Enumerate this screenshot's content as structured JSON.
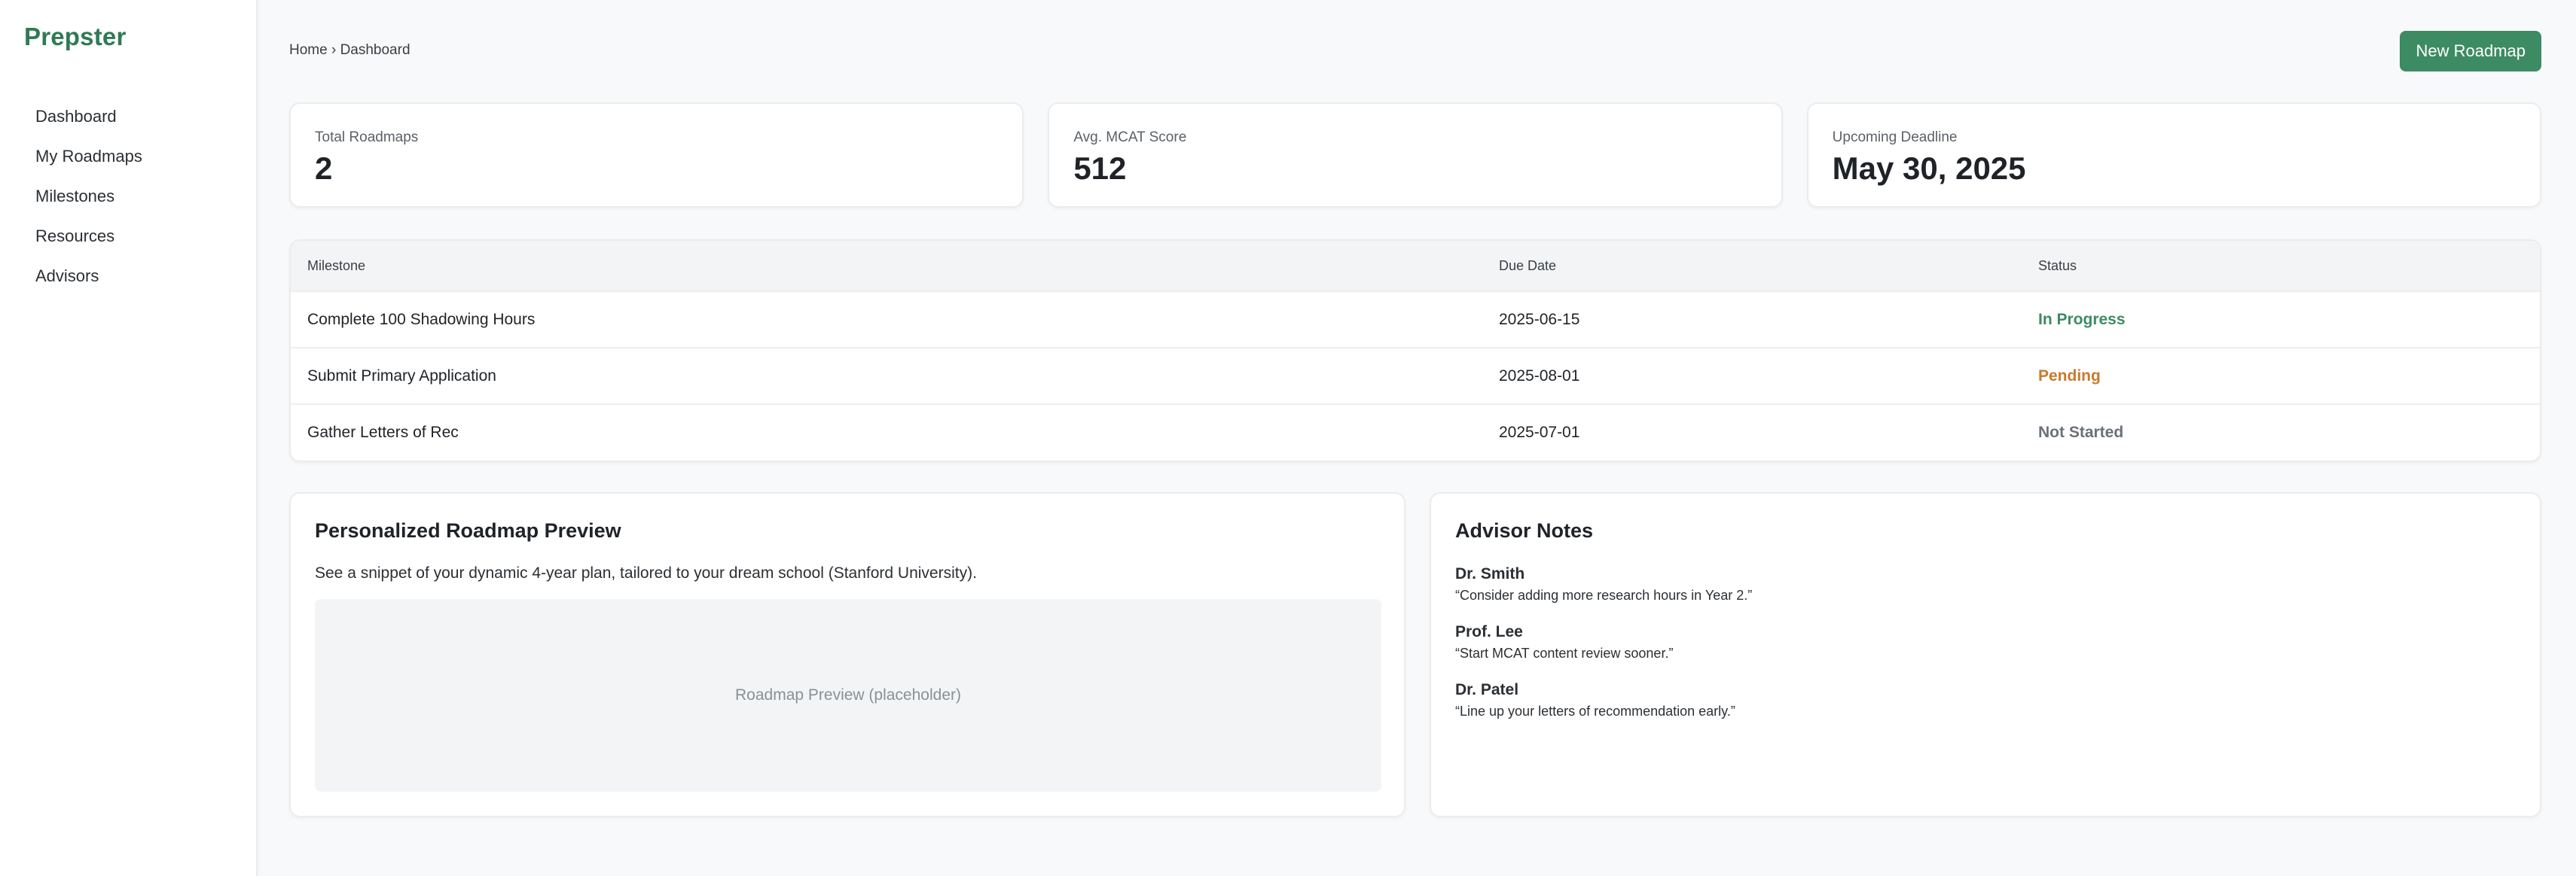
{
  "brand": {
    "name": "Prepster",
    "color": "#2f7a55"
  },
  "sidebar": {
    "items": [
      {
        "label": "Dashboard"
      },
      {
        "label": "My Roadmaps"
      },
      {
        "label": "Milestones"
      },
      {
        "label": "Resources"
      },
      {
        "label": "Advisors"
      }
    ]
  },
  "header": {
    "breadcrumb": "Home › Dashboard",
    "new_button_label": "New Roadmap",
    "accent_color": "#3d8b63"
  },
  "stats": [
    {
      "label": "Total Roadmaps",
      "value": "2"
    },
    {
      "label": "Avg. MCAT Score",
      "value": "512"
    },
    {
      "label": "Upcoming Deadline",
      "value": "May 30, 2025"
    }
  ],
  "milestones": {
    "columns": [
      "Milestone",
      "Due Date",
      "Status"
    ],
    "rows": [
      {
        "milestone": "Complete 100 Shadowing Hours",
        "due": "2025-06-15",
        "status": "In Progress",
        "status_color": "#3d8b63"
      },
      {
        "milestone": "Submit Primary Application",
        "due": "2025-08-01",
        "status": "Pending",
        "status_color": "#c97a2c"
      },
      {
        "milestone": "Gather Letters of Rec",
        "due": "2025-07-01",
        "status": "Not Started",
        "status_color": "#6b7177"
      }
    ]
  },
  "preview": {
    "title": "Personalized Roadmap Preview",
    "description": "See a snippet of your dynamic 4-year plan, tailored to your dream school (Stanford University).",
    "placeholder": "Roadmap Preview (placeholder)"
  },
  "advisor_notes": {
    "title": "Advisor Notes",
    "notes": [
      {
        "author": "Dr. Smith",
        "text": "“Consider adding more research hours in Year 2.”"
      },
      {
        "author": "Prof. Lee",
        "text": "“Start MCAT content review sooner.”"
      },
      {
        "author": "Dr. Patel",
        "text": "“Line up your letters of recommendation early.”"
      }
    ]
  }
}
